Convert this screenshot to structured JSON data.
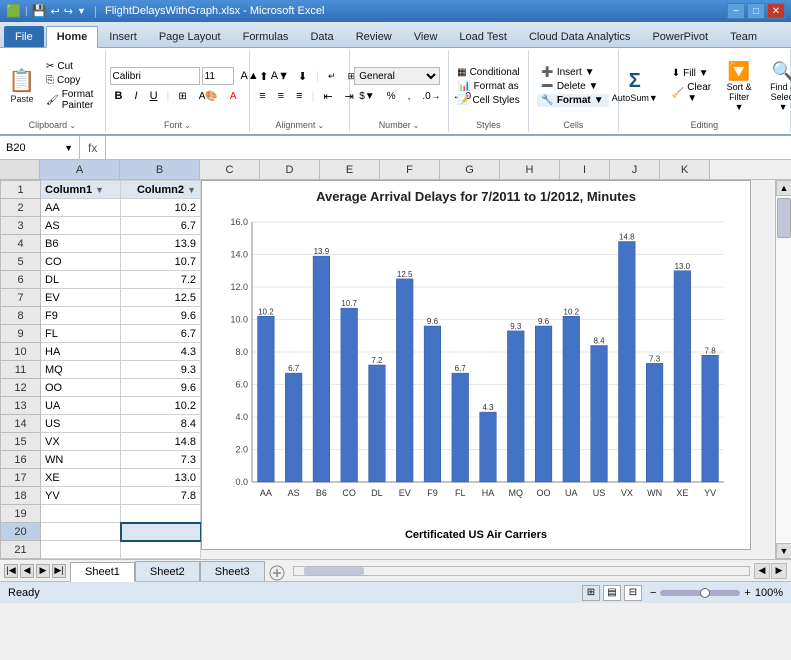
{
  "window": {
    "title": "FlightDelaysWithGraph.xlsx - Microsoft Excel",
    "minimize": "−",
    "maximize": "□",
    "close": "✕"
  },
  "ribbon": {
    "tabs": [
      "File",
      "Home",
      "Insert",
      "Page Layout",
      "Formulas",
      "Data",
      "Review",
      "View",
      "Load Test",
      "Cloud Data Analytics",
      "PowerPivot",
      "Team"
    ],
    "active_tab": "Home",
    "quick_access": [
      "💾",
      "↩",
      "↪"
    ],
    "groups": {
      "clipboard": {
        "label": "Clipboard",
        "paste_icon": "📋",
        "paste_label": "Paste",
        "cut_label": "Cut",
        "copy_label": "Copy",
        "format_painter_label": "Format Painter"
      },
      "font": {
        "label": "Font",
        "font_name": "Calibri",
        "font_size": "11",
        "bold": "B",
        "italic": "I",
        "underline": "U"
      },
      "alignment": {
        "label": "Alignment"
      },
      "number": {
        "label": "Number",
        "format": "General"
      },
      "styles": {
        "label": "Styles",
        "conditional_formatting": "Conditional Formatting",
        "format_as_table": "Format as Table",
        "cell_styles": "Cell Styles"
      },
      "cells": {
        "label": "Cells",
        "insert": "Insert",
        "delete": "Delete",
        "format": "Format"
      },
      "editing": {
        "label": "Editing",
        "autosum": "Σ",
        "fill": "Fill",
        "clear": "Clear",
        "sort_filter": "Sort & Filter",
        "find_select": "Find & Select"
      }
    }
  },
  "formula_bar": {
    "cell_ref": "B20",
    "fx_label": "fx",
    "formula": ""
  },
  "columns": {
    "headers": [
      "",
      "A",
      "B",
      "C",
      "D",
      "E",
      "F",
      "G",
      "H",
      "I",
      "J",
      "K"
    ],
    "widths": [
      40,
      80,
      80,
      400
    ]
  },
  "rows": [
    {
      "num": 1,
      "col_a": "Column1",
      "col_b": "Column2",
      "is_header": true
    },
    {
      "num": 2,
      "col_a": "AA",
      "col_b": "10.2"
    },
    {
      "num": 3,
      "col_a": "AS",
      "col_b": "6.7"
    },
    {
      "num": 4,
      "col_a": "B6",
      "col_b": "13.9"
    },
    {
      "num": 5,
      "col_a": "CO",
      "col_b": "10.7"
    },
    {
      "num": 6,
      "col_a": "DL",
      "col_b": "7.2"
    },
    {
      "num": 7,
      "col_a": "EV",
      "col_b": "12.5"
    },
    {
      "num": 8,
      "col_a": "F9",
      "col_b": "9.6"
    },
    {
      "num": 9,
      "col_a": "FL",
      "col_b": "6.7"
    },
    {
      "num": 10,
      "col_a": "HA",
      "col_b": "4.3"
    },
    {
      "num": 11,
      "col_a": "MQ",
      "col_b": "9.3"
    },
    {
      "num": 12,
      "col_a": "OO",
      "col_b": "9.6"
    },
    {
      "num": 13,
      "col_a": "UA",
      "col_b": "10.2"
    },
    {
      "num": 14,
      "col_a": "US",
      "col_b": "8.4"
    },
    {
      "num": 15,
      "col_a": "VX",
      "col_b": "14.8"
    },
    {
      "num": 16,
      "col_a": "WN",
      "col_b": "7.3"
    },
    {
      "num": 17,
      "col_a": "XE",
      "col_b": "13.0"
    },
    {
      "num": 18,
      "col_a": "YV",
      "col_b": "7.8"
    },
    {
      "num": 19,
      "col_a": "",
      "col_b": ""
    },
    {
      "num": 20,
      "col_a": "",
      "col_b": "",
      "is_active": true
    },
    {
      "num": 21,
      "col_a": "",
      "col_b": ""
    }
  ],
  "chart": {
    "title": "Average Arrival Delays for 7/2011 to 1/2012, Minutes",
    "x_label": "Certificated US Air Carriers",
    "y_max": 16.0,
    "y_min": 0.0,
    "y_ticks": [
      "0.0",
      "2.0",
      "4.0",
      "6.0",
      "8.0",
      "10.0",
      "12.0",
      "14.0",
      "16.0"
    ],
    "bars": [
      {
        "label": "AA",
        "value": 10.2
      },
      {
        "label": "AS",
        "value": 6.7
      },
      {
        "label": "B6",
        "value": 13.9
      },
      {
        "label": "CO",
        "value": 10.7
      },
      {
        "label": "DL",
        "value": 7.2
      },
      {
        "label": "EV",
        "value": 12.5
      },
      {
        "label": "F9",
        "value": 9.6
      },
      {
        "label": "FL",
        "value": 6.7
      },
      {
        "label": "HA",
        "value": 4.3
      },
      {
        "label": "MQ",
        "value": 9.3
      },
      {
        "label": "OO",
        "value": 9.6
      },
      {
        "label": "UA",
        "value": 10.2
      },
      {
        "label": "US",
        "value": 8.4
      },
      {
        "label": "VX",
        "value": 14.8
      },
      {
        "label": "WN",
        "value": 7.3
      },
      {
        "label": "XE",
        "value": 13.0
      },
      {
        "label": "YV",
        "value": 7.8
      }
    ],
    "bar_color": "#4472C4"
  },
  "sheets": {
    "tabs": [
      "Sheet1",
      "Sheet2",
      "Sheet3"
    ],
    "active": "Sheet1"
  },
  "status": {
    "ready": "Ready",
    "zoom": "100%"
  }
}
